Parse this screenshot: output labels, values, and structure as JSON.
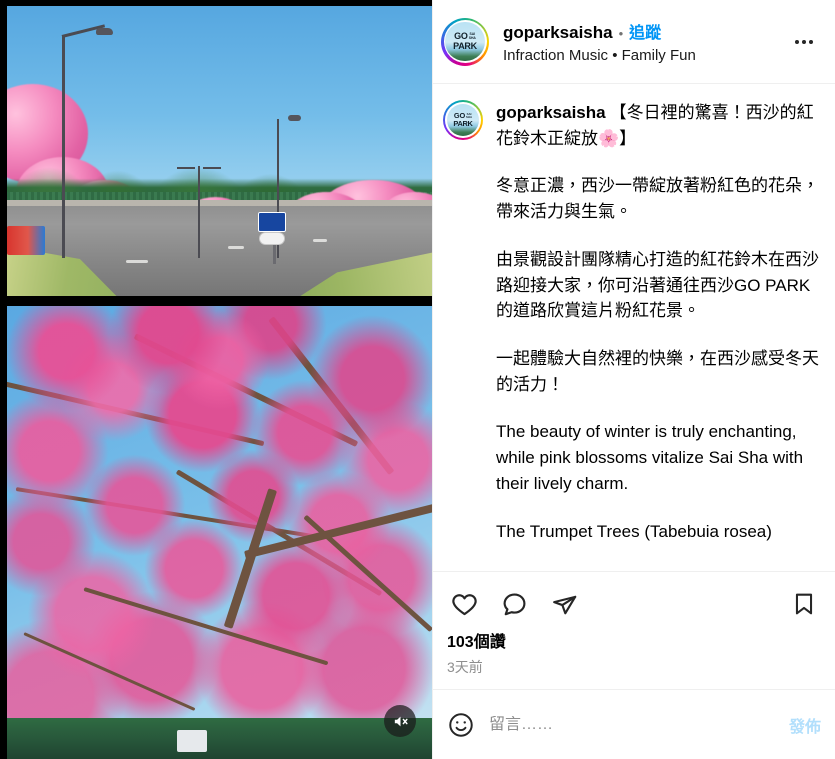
{
  "header": {
    "avatar_name": "gopark-sai-sha-logo",
    "logo_text": {
      "go": "GO",
      "sai": "SAI",
      "sha": "SHA",
      "park": "PARK"
    },
    "username": "goparksaisha",
    "separator": "•",
    "follow_label": "追蹤",
    "subtitle": "Infraction Music • Family Fun",
    "more_label": "更多選項"
  },
  "caption": {
    "username": "goparksaisha",
    "paragraphs": [
      "【冬日裡的驚喜！西沙的紅花鈴木正綻放🌸】",
      "冬意正濃，西沙一帶綻放著粉紅色的花朵，帶來活力與生氣。",
      "由景觀設計團隊精心打造的紅花鈴木在西沙路迎接大家，你可沿著通往西沙GO PARK的道路欣賞這片粉紅花景。",
      "一起體驗大自然裡的快樂，在西沙感受冬天的活力！",
      "The beauty of winter is truly enchanting, while pink blossoms vitalize Sai Sha with their lively charm.",
      "The Trumpet Trees (Tabebuia rosea)"
    ]
  },
  "actions": {
    "like_label": "讚",
    "comment_label": "留言",
    "share_label": "分享",
    "save_label": "儲存",
    "likes_count": "103個讚",
    "timestamp": "3天前"
  },
  "composer": {
    "emoji_label": "表情符號",
    "placeholder": "留言……",
    "value": "",
    "post_label": "發佈"
  },
  "media": {
    "mute_label": "取消靜音",
    "top_photo_alt": "西沙路兩旁盛開的粉紅花鈴木與街燈",
    "bottom_photo_alt": "藍天下盛開的粉紅花鈴木樹冠"
  },
  "colors": {
    "instagram_blue": "#0095f6",
    "post_btn_blue": "#b2dffc",
    "muted_gray": "#8e8e8e",
    "divider": "#efefef",
    "text": "#000000"
  }
}
